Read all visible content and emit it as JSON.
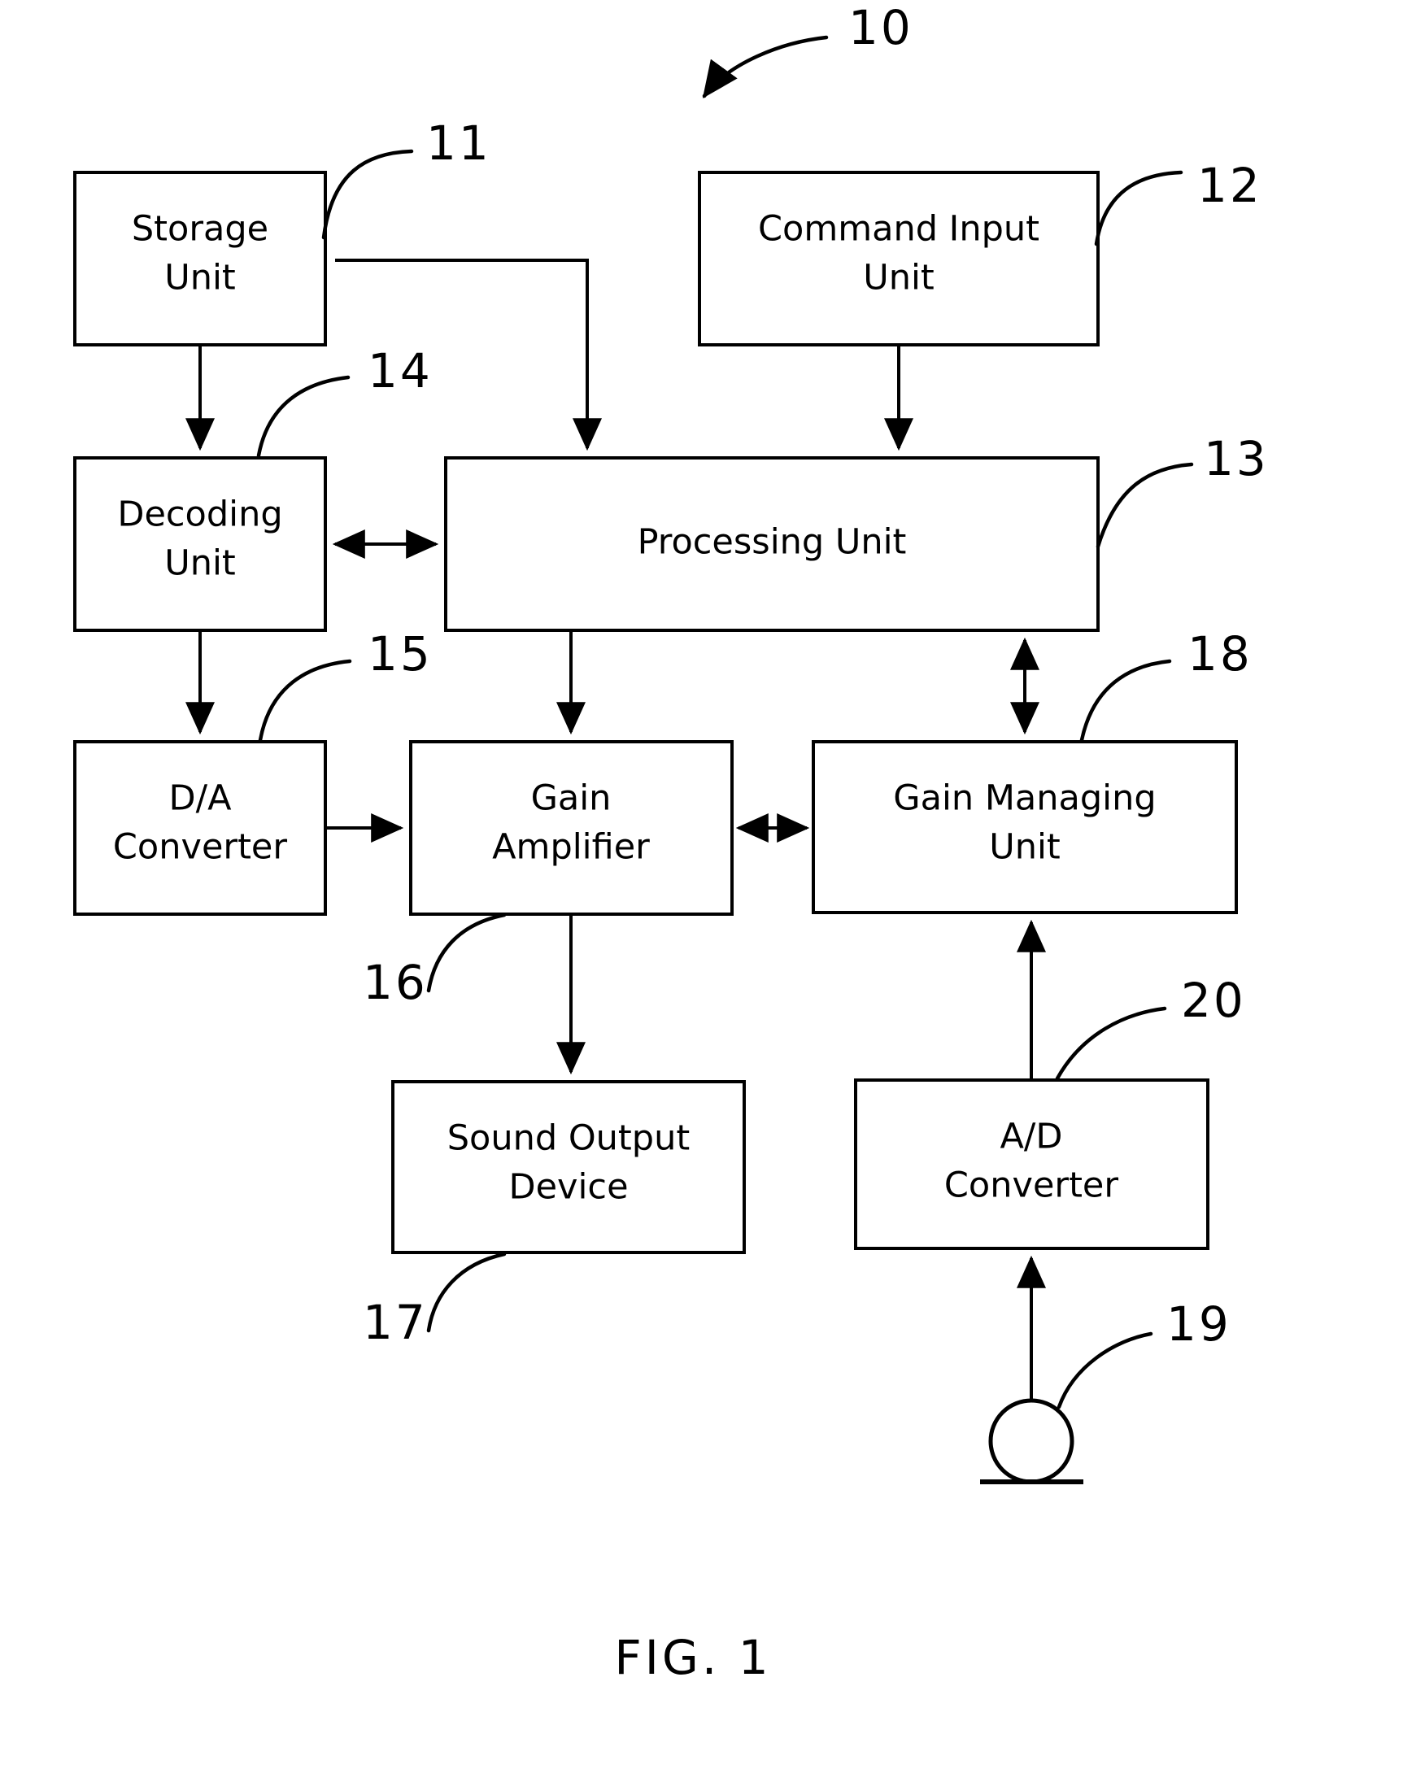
{
  "figure": {
    "caption": "FIG. 1",
    "system_ref": "10"
  },
  "blocks": [
    {
      "id": "storage-unit",
      "line1": "Storage",
      "line2": "Unit",
      "ref": "11"
    },
    {
      "id": "command-input-unit",
      "line1": "Command Input",
      "line2": "Unit",
      "ref": "12"
    },
    {
      "id": "decoding-unit",
      "line1": "Decoding",
      "line2": "Unit",
      "ref": "14"
    },
    {
      "id": "processing-unit",
      "line1": "Processing Unit",
      "line2": "",
      "ref": "13"
    },
    {
      "id": "da-converter",
      "line1": "D/A",
      "line2": "Converter",
      "ref": "15"
    },
    {
      "id": "gain-amplifier",
      "line1": "Gain",
      "line2": "Amplifier",
      "ref": "16"
    },
    {
      "id": "gain-managing-unit",
      "line1": "Gain Managing",
      "line2": "Unit",
      "ref": "18"
    },
    {
      "id": "sound-output-device",
      "line1": "Sound Output",
      "line2": "Device",
      "ref": "17"
    },
    {
      "id": "ad-converter",
      "line1": "A/D",
      "line2": "Converter",
      "ref": "20"
    },
    {
      "id": "microphone",
      "line1": "",
      "line2": "",
      "ref": "19"
    }
  ],
  "colors": {
    "stroke": "#000000",
    "fill": "#ffffff"
  }
}
